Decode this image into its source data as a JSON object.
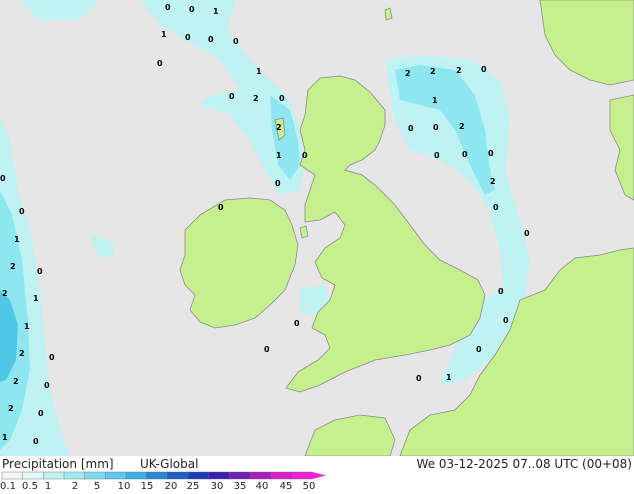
{
  "map": {
    "colors": {
      "sea": "#e6e6e6",
      "land": "#c6f08e",
      "coast": "#8a8a8a",
      "precip_light": "#bff3f3",
      "precip_mid": "#8ee6f0",
      "precip_heavy": "#4fc8e8"
    },
    "point_values": [
      {
        "id": "v1",
        "text": "0"
      },
      {
        "id": "v2",
        "text": "0"
      },
      {
        "id": "v3",
        "text": "1"
      },
      {
        "id": "v4",
        "text": "1"
      },
      {
        "id": "v5",
        "text": "0"
      },
      {
        "id": "v6",
        "text": "0"
      },
      {
        "id": "v7",
        "text": "0"
      },
      {
        "id": "v8",
        "text": "0"
      },
      {
        "id": "v9",
        "text": "1"
      },
      {
        "id": "v10",
        "text": "0"
      },
      {
        "id": "v11",
        "text": "2"
      },
      {
        "id": "v12",
        "text": "0"
      },
      {
        "id": "v13",
        "text": "2"
      },
      {
        "id": "v14",
        "text": "1"
      },
      {
        "id": "v15",
        "text": "0"
      },
      {
        "id": "v16",
        "text": "0"
      },
      {
        "id": "v17",
        "text": "2"
      },
      {
        "id": "v18",
        "text": "2"
      },
      {
        "id": "v19",
        "text": "2"
      },
      {
        "id": "v20",
        "text": "0"
      },
      {
        "id": "v21",
        "text": "1"
      },
      {
        "id": "v22",
        "text": "0"
      },
      {
        "id": "v23",
        "text": "0"
      },
      {
        "id": "v24",
        "text": "2"
      },
      {
        "id": "v25",
        "text": "0"
      },
      {
        "id": "v26",
        "text": "0"
      },
      {
        "id": "v27",
        "text": "0"
      },
      {
        "id": "v28",
        "text": "2"
      },
      {
        "id": "v29",
        "text": "0"
      },
      {
        "id": "v30",
        "text": "0"
      },
      {
        "id": "v31",
        "text": "0"
      },
      {
        "id": "v32",
        "text": "0"
      },
      {
        "id": "v33",
        "text": "0"
      },
      {
        "id": "v34",
        "text": "1"
      },
      {
        "id": "v35",
        "text": "2"
      },
      {
        "id": "v36",
        "text": "0"
      },
      {
        "id": "v37",
        "text": "2"
      },
      {
        "id": "v38",
        "text": "1"
      },
      {
        "id": "v39",
        "text": "1"
      },
      {
        "id": "v40",
        "text": "2"
      },
      {
        "id": "v41",
        "text": "0"
      },
      {
        "id": "v42",
        "text": "2"
      },
      {
        "id": "v43",
        "text": "0"
      },
      {
        "id": "v44",
        "text": "2"
      },
      {
        "id": "v45",
        "text": "0"
      },
      {
        "id": "v46",
        "text": "1"
      },
      {
        "id": "v47",
        "text": "0"
      },
      {
        "id": "v48",
        "text": "0"
      },
      {
        "id": "v49",
        "text": "0"
      },
      {
        "id": "v50",
        "text": "0"
      },
      {
        "id": "v51",
        "text": "0"
      },
      {
        "id": "v52",
        "text": "0"
      },
      {
        "id": "v53",
        "text": "1"
      },
      {
        "id": "v54",
        "text": "0"
      }
    ]
  },
  "legend": {
    "title": "Precipitation [mm]",
    "model": "UK-Global",
    "datetime": "We 03-12-2025 07..08 UTC (00+08)",
    "ticks": [
      "0.1",
      "0.5",
      "1",
      "2",
      "5",
      "10",
      "15",
      "20",
      "25",
      "30",
      "35",
      "40",
      "45",
      "50"
    ],
    "colors": [
      "#f5f5f5",
      "#e2fafa",
      "#bff3f3",
      "#9eeaf2",
      "#7fdcf0",
      "#5fc8ec",
      "#3faee6",
      "#2a86d8",
      "#1f5fc8",
      "#1a3db8",
      "#3a1fb0",
      "#6a1fb8",
      "#a81fc0",
      "#d81fc8",
      "#f01fd8"
    ]
  }
}
